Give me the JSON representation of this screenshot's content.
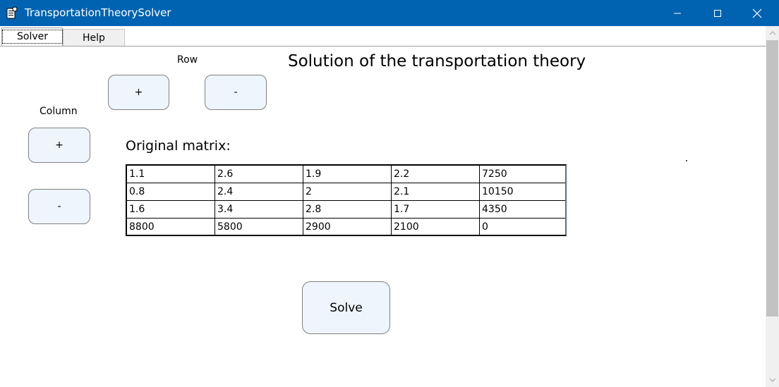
{
  "window": {
    "title": "TransportationTheorySolver",
    "controls": [
      "minimize-icon",
      "maximize-icon",
      "close-icon"
    ],
    "accent_color": "#0063b1"
  },
  "tabs": [
    {
      "label": "Solver",
      "selected": true
    },
    {
      "label": "Help",
      "selected": false
    }
  ],
  "labels": {
    "row": "Row",
    "column": "Column",
    "heading": "Solution of the transportation theory",
    "matrix_title": "Original matrix:"
  },
  "buttons": {
    "row_plus": "+",
    "row_minus": "-",
    "column_plus": "+",
    "column_minus": "-",
    "solve": "Solve"
  },
  "matrix": [
    [
      "1.1",
      "2.6",
      "1.9",
      "2.2",
      "7250"
    ],
    [
      "0.8",
      "2.4",
      "2",
      "2.1",
      "10150"
    ],
    [
      "1.6",
      "3.4",
      "2.8",
      "1.7",
      "4350"
    ],
    [
      "8800",
      "5800",
      "2900",
      "2100",
      "0"
    ]
  ]
}
